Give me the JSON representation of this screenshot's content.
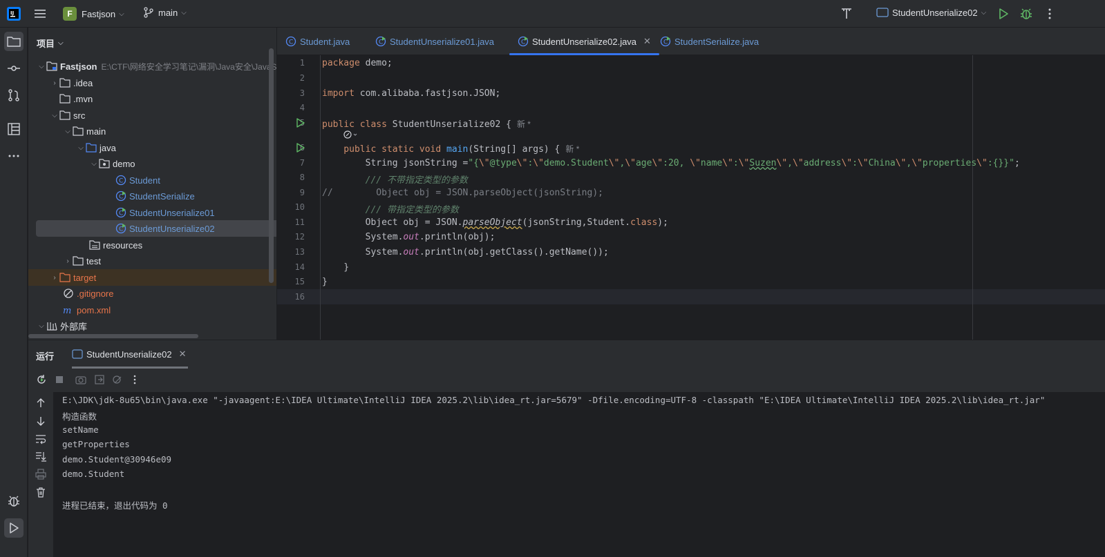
{
  "titlebar": {
    "project_initial": "F",
    "project_name": "Fastjson",
    "branch": "main",
    "run_config": "StudentUnserialize02"
  },
  "project_panel": {
    "title": "项目",
    "root": {
      "name": "Fastjson",
      "path": "E:\\CTF\\网络安全学习笔记\\漏洞\\Java安全\\JavaS"
    },
    "items": [
      {
        "label": ".idea"
      },
      {
        "label": ".mvn"
      },
      {
        "label": "src"
      },
      {
        "label": "main"
      },
      {
        "label": "java"
      },
      {
        "label": "demo"
      },
      {
        "label": "Student"
      },
      {
        "label": "StudentSerialize"
      },
      {
        "label": "StudentUnserialize01"
      },
      {
        "label": "StudentUnserialize02"
      },
      {
        "label": "resources"
      },
      {
        "label": "test"
      },
      {
        "label": "target"
      },
      {
        "label": ".gitignore"
      },
      {
        "label": "pom.xml"
      },
      {
        "label": "外部库"
      }
    ]
  },
  "tabs": [
    {
      "label": "Student.java"
    },
    {
      "label": "StudentUnserialize01.java"
    },
    {
      "label": "StudentUnserialize02.java"
    },
    {
      "label": "StudentSerialize.java"
    }
  ],
  "editor": {
    "line_numbers": [
      "1",
      "2",
      "3",
      "4",
      "5",
      "6",
      "7",
      "8",
      "9",
      "10",
      "11",
      "12",
      "13",
      "14",
      "15",
      "16"
    ],
    "new_hint": "新 *",
    "code": {
      "l1_kw": "package",
      "l1_rest": " demo;",
      "l3_kw": "import",
      "l3_rest": " com.alibaba.fastjson.JSON;",
      "l5_kw1": "public",
      "l5_kw2": "class",
      "l5_rest": " StudentUnserialize02 {",
      "l6_kw": "    public static void ",
      "l6_fn": "main",
      "l6_rest": "(String[] args) {",
      "l7_pre": "        String jsonString =",
      "l7_s1": "\"{",
      "l7_e1": "\\\"",
      "l7_s2": "@type",
      "l7_e2": "\\\"",
      "l7_s3": ":",
      "l7_e3": "\\\"",
      "l7_s4": "demo.Student",
      "l7_e4": "\\\"",
      "l7_s5": ",",
      "l7_e5": "\\\"",
      "l7_s6": "age",
      "l7_e6": "\\\"",
      "l7_s7": ":20, ",
      "l7_e7": "\\\"",
      "l7_s8": "name",
      "l7_e8": "\\\"",
      "l7_s9": ":",
      "l7_e9": "\\\"",
      "l7_s10": "Suzen",
      "l7_e10": "\\\"",
      "l7_s11": ",",
      "l7_e11": "\\\"",
      "l7_s12": "address",
      "l7_e12": "\\\"",
      "l7_s13": ":",
      "l7_e13": "\\\"",
      "l7_s14": "China",
      "l7_e14": "\\\"",
      "l7_s15": ",",
      "l7_e15": "\\\"",
      "l7_s16": "properties",
      "l7_e16": "\\\"",
      "l7_s17": ":{}}\"",
      "l7_end": ";",
      "l8": "        /// 不带指定类型的参数",
      "l9": "//        Object obj = JSON.parseObject(jsonString);",
      "l10": "        /// 带指定类型的参数",
      "l11_pre": "        Object obj = JSON.",
      "l11_it": "parseObject",
      "l11_mid": "(jsonString,Student.",
      "l11_kw": "class",
      "l11_end": ");",
      "l12_pre": "        System.",
      "l12_fld": "out",
      "l12_end": ".println(obj);",
      "l13_pre": "        System.",
      "l13_fld": "out",
      "l13_end": ".println(obj.getClass().getName());",
      "l14": "    }",
      "l15": "}"
    }
  },
  "run_panel": {
    "title": "运行",
    "tab": "StudentUnserialize02",
    "console": [
      "E:\\JDK\\jdk-8u65\\bin\\java.exe \"-javaagent:E:\\IDEA Ultimate\\IntelliJ IDEA 2025.2\\lib\\idea_rt.jar=5679\" -Dfile.encoding=UTF-8 -classpath \"E:\\IDEA Ultimate\\IntelliJ IDEA 2025.2\\lib\\idea_rt.jar\"",
      "构造函数",
      "setName",
      "getProperties",
      "demo.Student@30946e09",
      "demo.Student",
      "",
      "进程已结束，退出代码为 0"
    ]
  },
  "colors": {
    "accent": "#3574f0",
    "run_green": "#5fb865",
    "folder_orange": "#e8754a"
  }
}
